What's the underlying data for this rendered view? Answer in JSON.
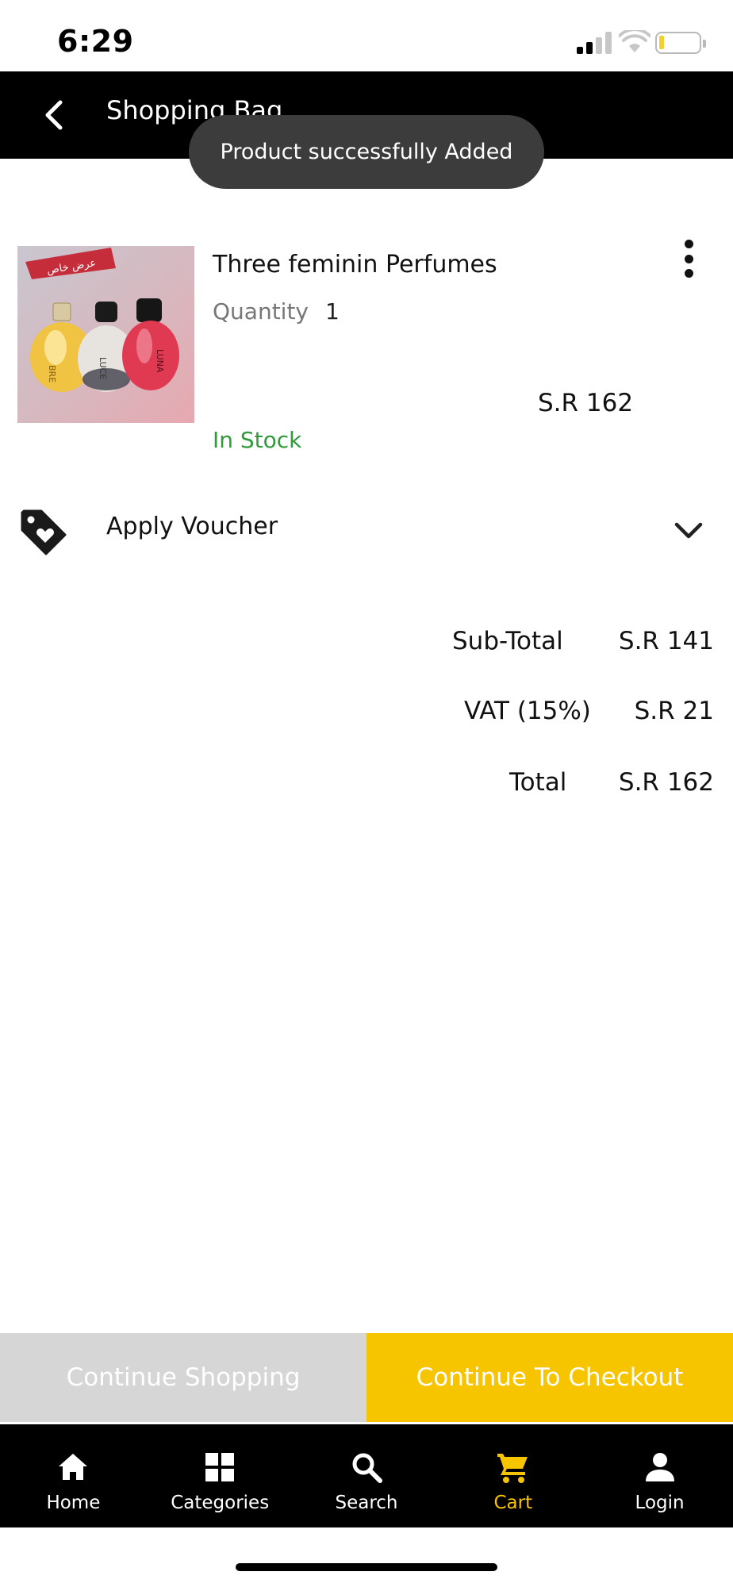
{
  "status_bar": {
    "time": "6:29"
  },
  "header": {
    "title": "Shopping Bag"
  },
  "toast": {
    "message": "Product successfully Added"
  },
  "product": {
    "name": "Three feminin Perfumes",
    "quantity_label": "Quantity",
    "quantity_value": "1",
    "price": "S.R 162",
    "stock_status": "In Stock",
    "image_badge_text": "عرض خاص",
    "bottle_labels": [
      "BRE",
      "LUCE",
      "LUNA"
    ]
  },
  "voucher": {
    "label": "Apply Voucher"
  },
  "summary": {
    "subtotal_label": "Sub-Total",
    "subtotal_value": "S.R 141",
    "vat_label": "VAT (15%)",
    "vat_value": "S.R 21",
    "total_label": "Total",
    "total_value": "S.R 162"
  },
  "actions": {
    "continue_shopping": "Continue Shopping",
    "checkout": "Continue To Checkout"
  },
  "bottom_nav": {
    "items": [
      {
        "label": "Home",
        "icon": "home-icon"
      },
      {
        "label": "Categories",
        "icon": "grid-icon"
      },
      {
        "label": "Search",
        "icon": "search-icon"
      },
      {
        "label": "Cart",
        "icon": "cart-icon",
        "active": true
      },
      {
        "label": "Login",
        "icon": "user-icon"
      }
    ]
  },
  "colors": {
    "accent": "#f7c400",
    "header_bg": "#000000",
    "in_stock": "#2f9b3a",
    "secondary_button": "#d6d6d6"
  }
}
